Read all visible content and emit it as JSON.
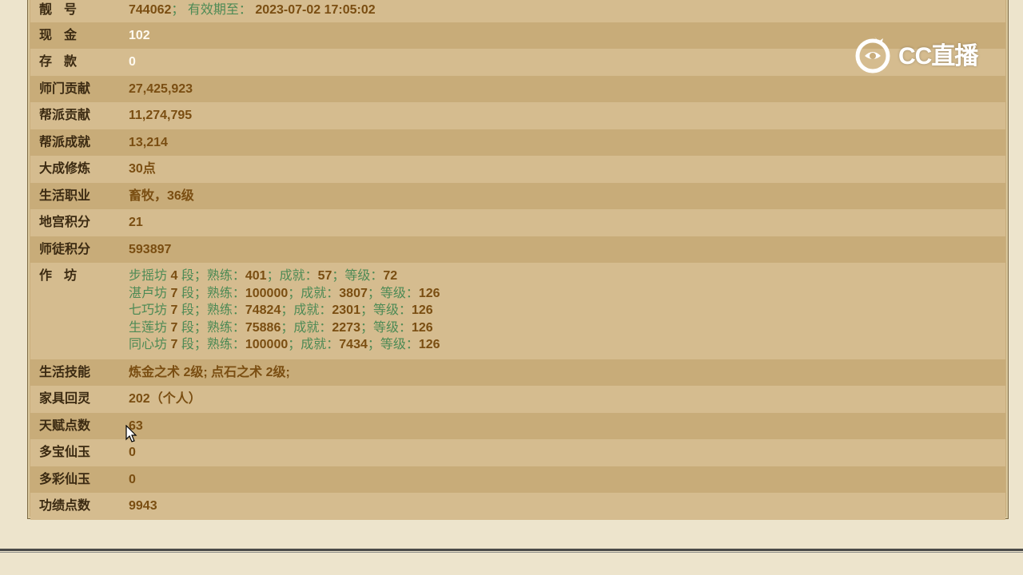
{
  "account": {
    "label": "靓号",
    "number": "744062",
    "sep": "；",
    "expiry_label": "有效期至：",
    "expiry": "2023-07-02 17:05:02"
  },
  "rows": [
    {
      "label": "现金",
      "value": "102"
    },
    {
      "label": "存款",
      "value": "0"
    },
    {
      "label": "师门贡献",
      "value": "27,425,923"
    },
    {
      "label": "帮派贡献",
      "value": "11,274,795"
    },
    {
      "label": "帮派成就",
      "value": "13,214"
    },
    {
      "label": "大成修炼",
      "value": "30点"
    },
    {
      "label": "生活职业",
      "value": "畜牧，36级"
    },
    {
      "label": "地宫积分",
      "value": "21"
    },
    {
      "label": "师徒积分",
      "value": "593897"
    }
  ],
  "workshop": {
    "label": "作坊",
    "items": [
      {
        "name": "步摇坊",
        "seg": "4",
        "prof": "401",
        "ach": "57",
        "lvl": "72"
      },
      {
        "name": "湛卢坊",
        "seg": "7",
        "prof": "100000",
        "ach": "3807",
        "lvl": "126"
      },
      {
        "name": "七巧坊",
        "seg": "7",
        "prof": "74824",
        "ach": "2301",
        "lvl": "126"
      },
      {
        "name": "生莲坊",
        "seg": "7",
        "prof": "75886",
        "ach": "2273",
        "lvl": "126"
      },
      {
        "name": "同心坊",
        "seg": "7",
        "prof": "100000",
        "ach": "7434",
        "lvl": "126"
      }
    ],
    "seg_word": "段；",
    "prof_word": "熟练：",
    "ach_word": "；成就：",
    "lvl_word": "；等级："
  },
  "rows2": [
    {
      "label": "生活技能",
      "value": "炼金之术 2级; 点石之术 2级;"
    },
    {
      "label": "家具回灵",
      "value": "202（个人）"
    },
    {
      "label": "天赋点数",
      "value": "63"
    },
    {
      "label": "多宝仙玉",
      "value": "0"
    },
    {
      "label": "多彩仙玉",
      "value": "0"
    },
    {
      "label": "功绩点数",
      "value": "9943"
    }
  ],
  "logo": {
    "text": "CC直播",
    "icon": "cc-live-logo-icon"
  },
  "cursor": {
    "icon": "mouse-pointer-icon"
  }
}
